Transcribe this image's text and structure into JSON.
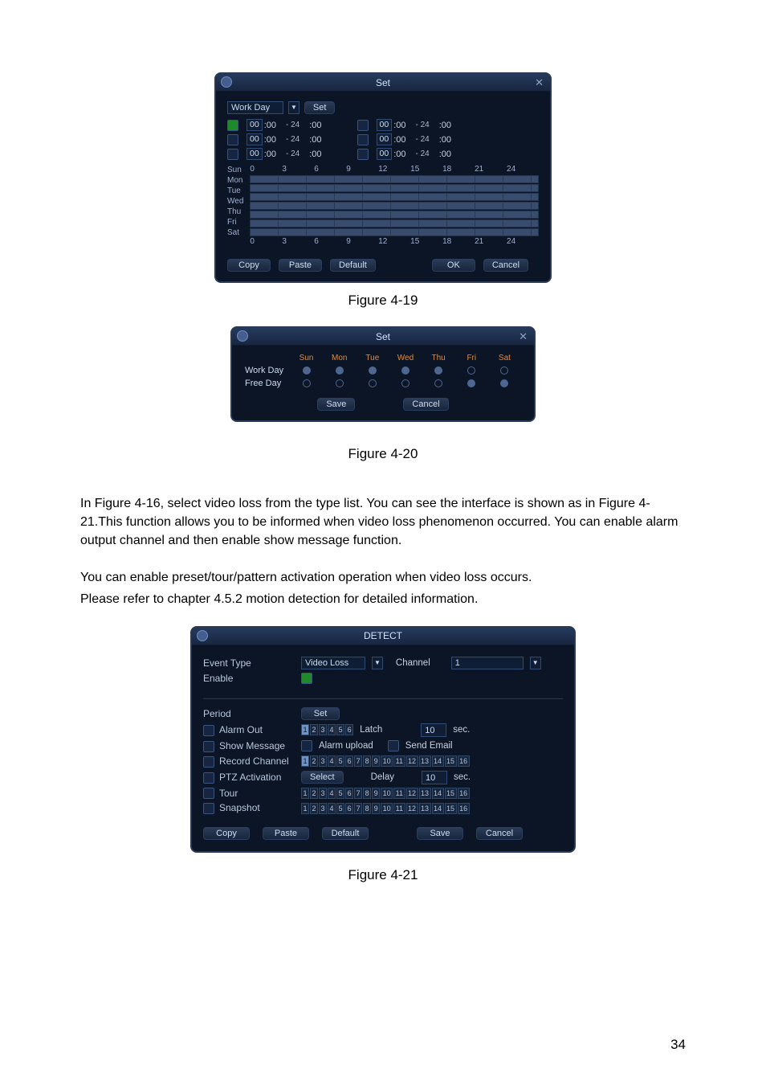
{
  "figures": {
    "set_dialog": {
      "title": "Set",
      "day_select": "Work Day",
      "set_btn": "Set",
      "time_rows": [
        {
          "checked": true,
          "start": [
            "00",
            ":00"
          ],
          "arrow": "- 24",
          "mid": ":00",
          "pair2_checked": false,
          "start2": [
            "00",
            ":00"
          ],
          "arrow2": "- 24",
          "mid2": ":00"
        },
        {
          "checked": false,
          "start": [
            "00",
            ":00"
          ],
          "arrow": "- 24",
          "mid": ":00",
          "pair2_checked": false,
          "start2": [
            "00",
            ":00"
          ],
          "arrow2": "- 24",
          "mid2": ":00"
        },
        {
          "checked": false,
          "start": [
            "00",
            ":00"
          ],
          "arrow": "- 24",
          "mid": ":00",
          "pair2_checked": false,
          "start2": [
            "00",
            ":00"
          ],
          "arrow2": "- 24",
          "mid2": ":00"
        }
      ],
      "days": [
        "Sun",
        "Mon",
        "Tue",
        "Wed",
        "Thu",
        "Fri",
        "Sat"
      ],
      "hours": [
        "0",
        "3",
        "6",
        "9",
        "12",
        "15",
        "18",
        "21",
        "24"
      ],
      "buttons": [
        "Copy",
        "Paste",
        "Default",
        "OK",
        "Cancel"
      ]
    },
    "cap1": "Figure 4-19",
    "week_dialog": {
      "title": "Set",
      "headers": [
        "Sun",
        "Mon",
        "Tue",
        "Wed",
        "Thu",
        "Fri",
        "Sat"
      ],
      "rows": [
        {
          "label": "Work Day",
          "sel": [
            1,
            1,
            1,
            1,
            1,
            0,
            0
          ]
        },
        {
          "label": "Free Day",
          "sel": [
            0,
            0,
            0,
            0,
            0,
            1,
            1
          ]
        }
      ],
      "buttons": [
        "Save",
        "Cancel"
      ]
    },
    "cap2": "Figure 4-20",
    "detect_dialog": {
      "title": "DETECT",
      "rows": {
        "event_type": {
          "label": "Event Type",
          "value": "Video Loss",
          "chan_label": "Channel",
          "chan_value": "1"
        },
        "enable": {
          "label": "Enable"
        },
        "period": {
          "label": "Period",
          "btn": "Set"
        },
        "alarm_out": {
          "label": "Alarm Out",
          "nums": [
            "1",
            "2",
            "3",
            "4",
            "5",
            "6"
          ],
          "sel": [
            1,
            0,
            0,
            0,
            0,
            0
          ],
          "latch": "Latch",
          "latch_val": "10",
          "sec": "sec."
        },
        "show_msg": {
          "label": "Show Message",
          "alarm_upload": "Alarm upload",
          "send_email": "Send Email"
        },
        "rec_ch": {
          "label": "Record Channel",
          "nums": [
            "1",
            "2",
            "3",
            "4",
            "5",
            "6",
            "7",
            "8",
            "9",
            "10",
            "11",
            "12",
            "13",
            "14",
            "15",
            "16"
          ],
          "sel": [
            1,
            0,
            0,
            0,
            0,
            0,
            0,
            0,
            0,
            0,
            0,
            0,
            0,
            0,
            0,
            0
          ]
        },
        "ptz": {
          "label": "PTZ Activation",
          "btn": "Select",
          "delay": "Delay",
          "delay_val": "10",
          "sec": "sec."
        },
        "tour": {
          "label": "Tour",
          "nums": [
            "1",
            "2",
            "3",
            "4",
            "5",
            "6",
            "7",
            "8",
            "9",
            "10",
            "11",
            "12",
            "13",
            "14",
            "15",
            "16"
          ],
          "sel": [
            0,
            0,
            0,
            0,
            0,
            0,
            0,
            0,
            0,
            0,
            0,
            0,
            0,
            0,
            0,
            0
          ]
        },
        "snapshot": {
          "label": "Snapshot",
          "nums": [
            "1",
            "2",
            "3",
            "4",
            "5",
            "6",
            "7",
            "8",
            "9",
            "10",
            "11",
            "12",
            "13",
            "14",
            "15",
            "16"
          ],
          "sel": [
            0,
            0,
            0,
            0,
            0,
            0,
            0,
            0,
            0,
            0,
            0,
            0,
            0,
            0,
            0,
            0
          ]
        }
      },
      "buttons": [
        "Copy",
        "Paste",
        "Default",
        "Save",
        "Cancel"
      ]
    },
    "cap3": "Figure 4-21"
  },
  "paragraphs": {
    "p1": "In Figure 4-16, select video loss from the type list. You can see the interface is shown as in Figure 4-21.This function allows you to be informed when video loss phenomenon occurred. You can enable alarm output channel and then enable show message function.",
    "p2": "You can enable preset/tour/pattern activation operation when video loss occurs.",
    "p3": "Please refer to chapter 4.5.2 motion detection for detailed information."
  },
  "page_number": "34"
}
